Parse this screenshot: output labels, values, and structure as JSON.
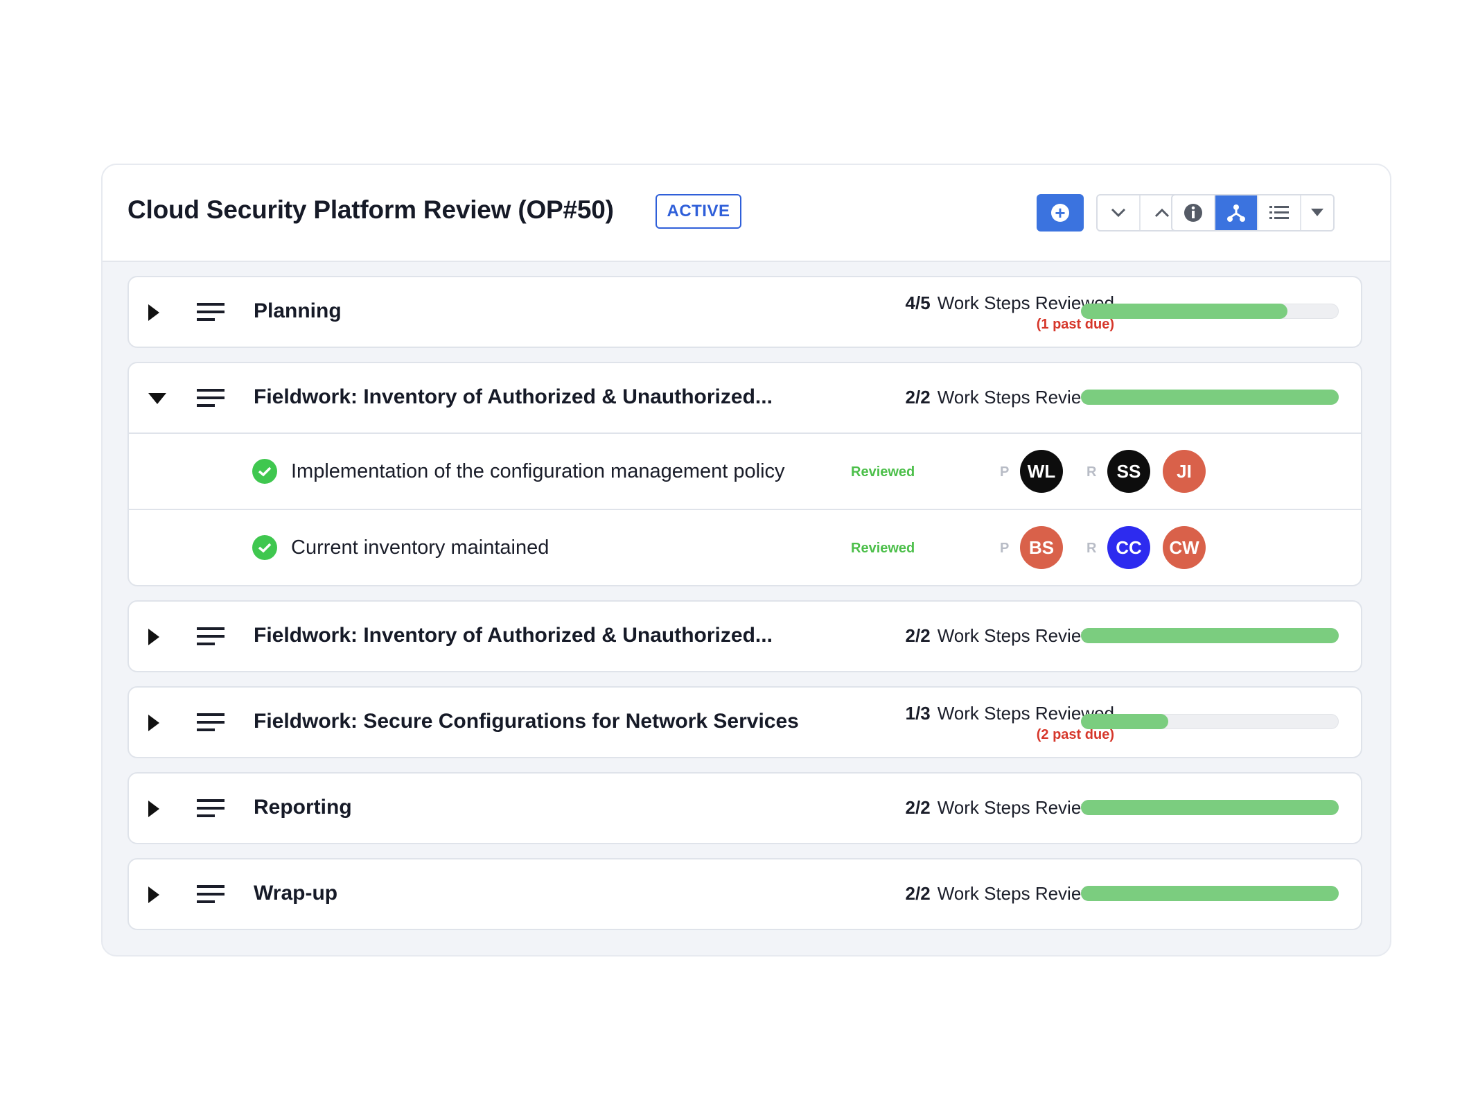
{
  "header": {
    "title": "Cloud Security Platform Review (OP#50)",
    "status": "ACTIVE"
  },
  "toolbar": {
    "add_icon": "plus-circle-icon",
    "collapse_icon": "chevron-down-icon",
    "expand_icon": "chevron-up-icon",
    "info_icon": "info-icon",
    "tree_view_icon": "tree-icon",
    "list_view_icon": "list-icon",
    "dropdown_icon": "caret-down-icon",
    "accent": "#3b73df"
  },
  "sections": [
    {
      "title": "Planning",
      "count": "4/5",
      "label": "Work Steps Reviewed",
      "past_due": "(1 past due)",
      "progress": 0.8,
      "expanded": false
    },
    {
      "title": "Fieldwork: Inventory of Authorized & Unauthorized...",
      "count": "2/2",
      "label": "Work Steps Reviewed",
      "progress": 1.0,
      "expanded": true,
      "steps": [
        {
          "title": "Implementation of the configuration management policy",
          "status": "Reviewed",
          "preparer_role": "P",
          "preparer": {
            "initials": "WL",
            "color": "#0d0d0d"
          },
          "reviewer_role": "R",
          "reviewers": [
            {
              "initials": "SS",
              "color": "#0d0d0d"
            },
            {
              "initials": "JI",
              "color": "#d9614a"
            }
          ]
        },
        {
          "title": "Current inventory maintained",
          "status": "Reviewed",
          "preparer_role": "P",
          "preparer": {
            "initials": "BS",
            "color": "#d9614a"
          },
          "reviewer_role": "R",
          "reviewers": [
            {
              "initials": "CC",
              "color": "#2d2bef"
            },
            {
              "initials": "CW",
              "color": "#d9614a"
            }
          ]
        }
      ]
    },
    {
      "title": "Fieldwork: Inventory of Authorized & Unauthorized...",
      "count": "2/2",
      "label": "Work Steps Reviewed",
      "progress": 1.0,
      "expanded": false
    },
    {
      "title": "Fieldwork: Secure Configurations for Network Services",
      "count": "1/3",
      "label": "Work Steps Reviewed",
      "past_due": "(2 past due)",
      "progress": 0.34,
      "expanded": false
    },
    {
      "title": "Reporting",
      "count": "2/2",
      "label": "Work Steps Reviewed",
      "progress": 1.0,
      "expanded": false
    },
    {
      "title": "Wrap-up",
      "count": "2/2",
      "label": "Work Steps Reviewed",
      "progress": 1.0,
      "expanded": false
    }
  ]
}
